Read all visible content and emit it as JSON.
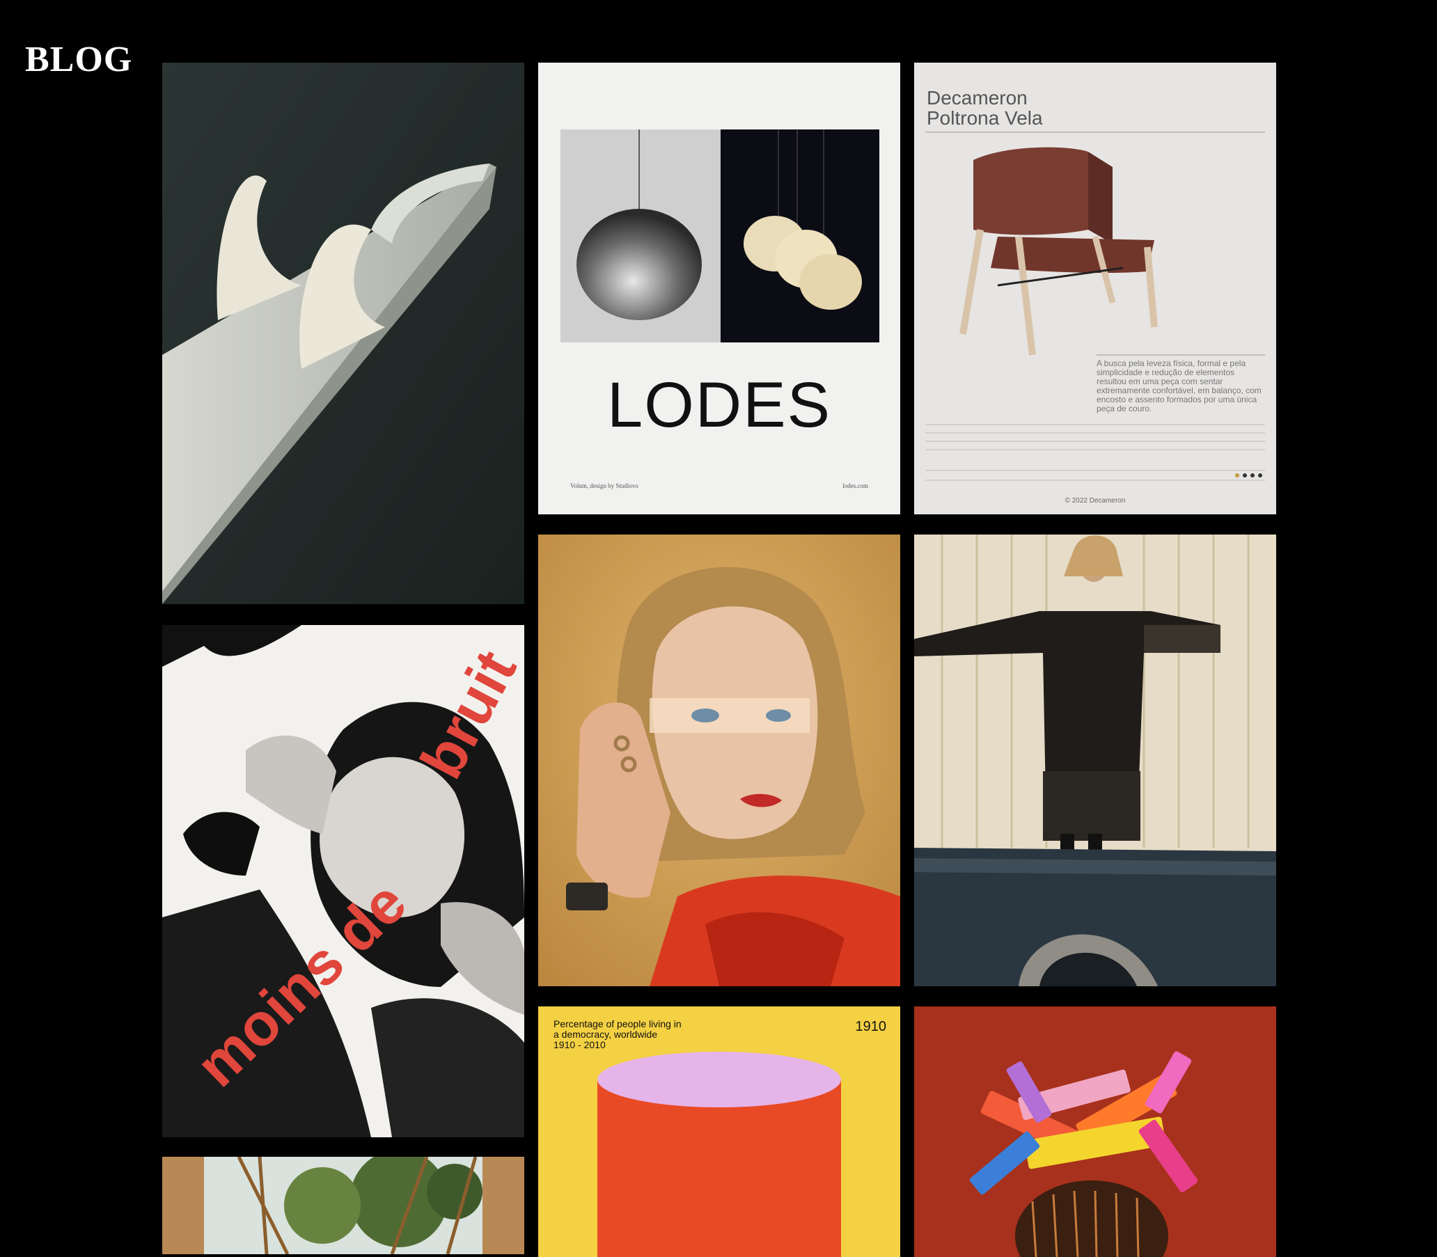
{
  "site": {
    "logo": "BLOG"
  },
  "posts": {
    "lodes": {
      "brand": "LODES",
      "caption": "Volum, design by Studiovo",
      "site": "lodes.com"
    },
    "decameron": {
      "title_line1": "Decameron",
      "title_line2": "Poltrona Vela",
      "description": "A busca pela leveza física, formal e pela simplicidade e redução de elementos resultou em uma peça com sentar extremamente confortável, em balanço, com encosto e assento formados por uma única peça de couro.",
      "footer": "© 2022 Decameron"
    },
    "bruit": {
      "word1": "moins de",
      "word2": "bruit"
    },
    "democracy": {
      "title_line1": "Percentage of people living in",
      "title_line2": "a democracy, worldwide",
      "title_line3": "1910 - 2010",
      "year": "1910"
    }
  },
  "colors": {
    "background": "#000000",
    "logo": "#ffffff",
    "bruit_red": "#e0463b",
    "democracy_yellow": "#f4d143",
    "democracy_pink": "#e5b4e9",
    "democracy_red": "#e84a25",
    "combs_red": "#a7311c"
  }
}
